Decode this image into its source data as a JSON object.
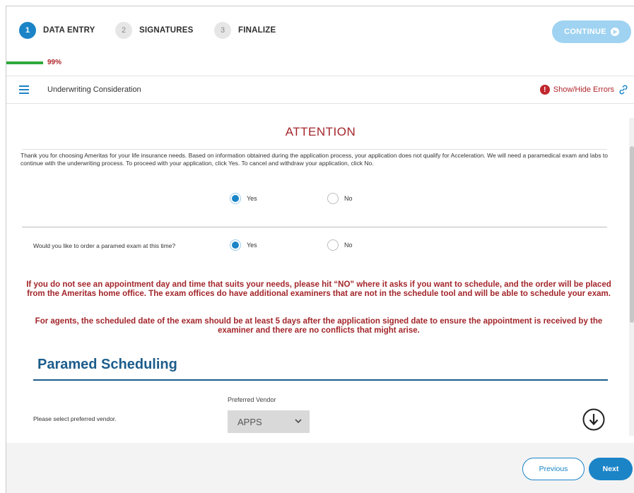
{
  "stepper": {
    "steps": [
      {
        "num": "1",
        "label": "DATA ENTRY"
      },
      {
        "num": "2",
        "label": "SIGNATURES"
      },
      {
        "num": "3",
        "label": "FINALIZE"
      }
    ],
    "continue_label": "CONTINUE",
    "active_step_color": "#1a84c7"
  },
  "progress": {
    "value": 0.99,
    "label": "99%",
    "bar_color": "#2eaa3c"
  },
  "section": {
    "title": "Underwriting Consideration",
    "errors_link": "Show/Hide Errors"
  },
  "attention": {
    "heading": "ATTENTION",
    "message": "Thank you for choosing Ameritas for your life insurance needs. Based on information obtained during the application process, your application does not qualify for Acceleration. We will need a paramedical exam and labs to continue with the underwriting process. To proceed with your application, click Yes. To cancel and withdraw your application, click No.",
    "options": {
      "yes": "Yes",
      "no": "No",
      "selected": "yes"
    }
  },
  "paramed_question": {
    "text": "Would you like to order a paramed exam at this time?",
    "options": {
      "yes": "Yes",
      "no": "No",
      "selected": "yes"
    }
  },
  "notices": {
    "first": "If you do not see an appointment day and time that suits your needs, please hit “NO” where it asks if you want to schedule, and the order will be placed from the Ameritas home office. The exam offices do have additional examiners that are not in the schedule tool and will be able to schedule your exam.",
    "second": "For agents, the scheduled date of the exam should be at least 5 days after the application signed date to ensure the appointment is received by the examiner and there are no conflicts that might arise."
  },
  "scheduling": {
    "title": "Paramed Scheduling",
    "vendor_label": "Preferred Vendor",
    "vendor_prompt": "Please select preferred vendor.",
    "vendor_value": "APPS"
  },
  "footer": {
    "previous_label": "Previous",
    "next_label": "Next"
  },
  "colors": {
    "accent": "#1a84c7",
    "alert_red": "#a3262b",
    "heading_navy": "#1c5d8c"
  },
  "icons": {
    "menu": "hamburger-menu-icon",
    "error": "exclamation-circle-icon",
    "link": "chain-link-icon",
    "continue": "arrow-right-circle-icon",
    "select": "chevron-down-icon",
    "download": "download-circle-icon"
  }
}
